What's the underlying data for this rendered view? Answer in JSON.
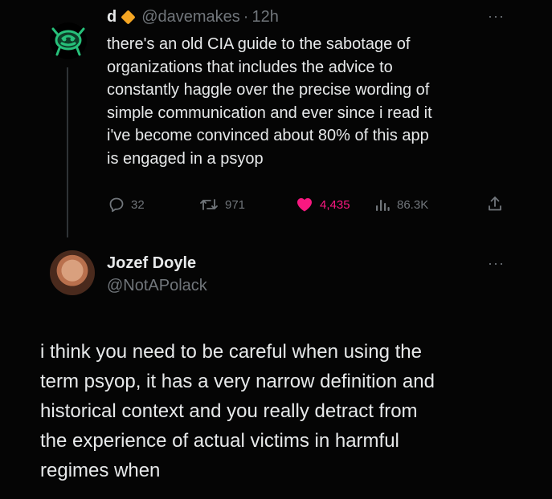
{
  "tweet": {
    "author_name": "d",
    "handle": "@davemakes",
    "separator": "·",
    "time": "12h",
    "more": "···",
    "text": "there's an old CIA guide to the sabotage of\norganizations that includes the advice to\nconstantly haggle over the precise wording of\nsimple communication and ever since i read it\ni've become convinced about 80% of this app\nis engaged in a psyop",
    "stats": {
      "replies": "32",
      "retweets": "971",
      "likes": "4,435",
      "views": "86.3K"
    },
    "colors": {
      "like": "#f91880",
      "verified_badge": "#f5a623",
      "avatar": "#27c07a"
    }
  },
  "reply": {
    "author_name": "Jozef Doyle",
    "handle": "@NotAPolack",
    "more": "···",
    "text": "i think you need to be careful when using the\nterm psyop, it has a very narrow definition and\nhistorical context and you really detract from\nthe experience of actual victims in harmful\nregimes when"
  }
}
